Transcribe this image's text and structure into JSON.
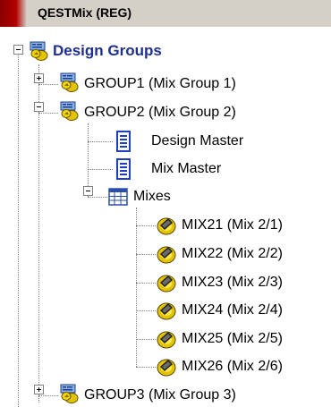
{
  "header": {
    "title": "QESTMix (REG)"
  },
  "tree": {
    "root": {
      "label": "Design Groups"
    },
    "groups": [
      {
        "label": "GROUP1 (Mix Group 1)"
      },
      {
        "label": "GROUP2 (Mix Group 2)"
      },
      {
        "label": "GROUP3 (Mix Group 3)"
      }
    ],
    "group2_children": {
      "design_master": "Design Master",
      "mix_master": "Mix Master",
      "mixes": "Mixes",
      "mix_items": [
        "MIX21 (Mix 2/1)",
        "MIX22 (Mix 2/2)",
        "MIX23 (Mix 2/3)",
        "MIX24 (Mix 2/4)",
        "MIX25 (Mix 2/5)",
        "MIX26 (Mix 2/6)"
      ]
    }
  },
  "icons": {
    "group": "design-group-icon",
    "document": "document-icon",
    "grid": "grid-table-icon",
    "mix": "mix-icon"
  },
  "colors": {
    "header_bg": "#d4d0c8",
    "header_accent": "#b40000",
    "root_label": "#1f2f8f",
    "connector": "#808080"
  }
}
